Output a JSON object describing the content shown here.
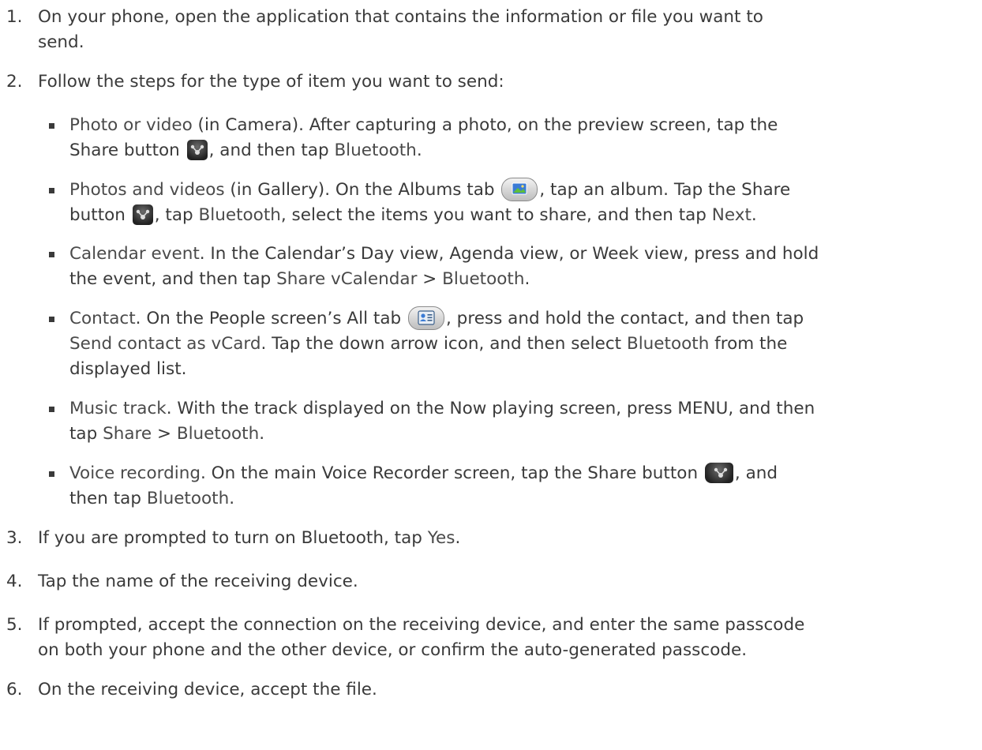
{
  "steps": [
    {
      "num": "1.",
      "line1": "On your phone, open the application that contains the information or file you want to",
      "line2": "send."
    },
    {
      "num": "2.",
      "text": "Follow the steps for the type of item you want to send:"
    },
    {
      "num": "3.",
      "pre": "If you are prompted to turn on Bluetooth, tap ",
      "kw": "Yes",
      "post": "."
    },
    {
      "num": "4.",
      "text": "Tap the name of the receiving device."
    },
    {
      "num": "5.",
      "line1": "If prompted, accept the connection on the receiving device, and enter the same passcode",
      "line2": "on both your phone and the other device, or confirm the auto-generated passcode."
    },
    {
      "num": "6.",
      "text": "On the receiving device, accept the file."
    }
  ],
  "bullets": {
    "photo": {
      "kw": "Photo or video",
      "t1": " (in Camera). After capturing a photo, on the preview screen, tap the",
      "t2": "Share button ",
      "t3": ", and then tap ",
      "kw2": "Bluetooth",
      "t4": "."
    },
    "gallery": {
      "kw": "Photos and videos",
      "t1": " (in Gallery). On the Albums tab ",
      "t2": ", tap an album. Tap the Share",
      "t3": "button ",
      "t4": ", tap ",
      "kw2": "Bluetooth",
      "t5": ", select the items you want to share, and then tap ",
      "kw3": "Next",
      "t6": "."
    },
    "calendar": {
      "kw": "Calendar event",
      "t1": ". In the Calendar’s Day view, Agenda view, or Week view, press and hold",
      "t2": "the event, and then tap ",
      "kw2": "Share vCalendar",
      "t3": " > ",
      "kw3": "Bluetooth",
      "t4": "."
    },
    "contact": {
      "kw": "Contact",
      "t1": ". On the People screen’s All tab ",
      "t2": ", press and hold the contact, and then tap",
      "kw2": "Send contact as vCard",
      "t3": ". Tap the down arrow icon, and then select ",
      "kw3": "Bluetooth",
      "t4": " from the",
      "t5": "displayed list."
    },
    "music": {
      "kw": "Music track",
      "t1": ". With the track displayed on the Now playing screen, press MENU, and then",
      "t2": "tap ",
      "kw2": "Share",
      "t3": " > ",
      "kw3": "Bluetooth",
      "t4": "."
    },
    "voice": {
      "kw": "Voice recording",
      "t1": ". On the main Voice Recorder screen, tap the Share button ",
      "t2": ", and",
      "t3": "then tap ",
      "kw2": "Bluetooth",
      "t4": "."
    }
  }
}
